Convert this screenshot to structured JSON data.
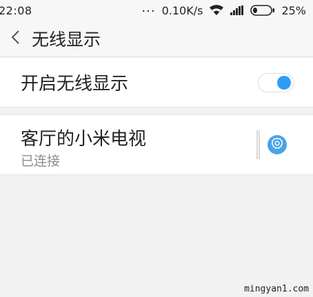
{
  "status_bar": {
    "time": "22:08",
    "dots": "...",
    "speed": "0.10K/s",
    "battery_percent": "25%",
    "battery_level": 0.25,
    "icons": [
      "wifi-icon",
      "signal-icon",
      "battery-icon"
    ]
  },
  "header": {
    "title": "无线显示",
    "back_icon": "chevron-left-icon"
  },
  "toggle_row": {
    "label": "开启无线显示",
    "enabled": true,
    "accent": "#2f9df6"
  },
  "device": {
    "name": "客厅的小米电视",
    "status": "已连接",
    "settings_icon": "gear-icon",
    "icon_color": "#4aa3e8"
  },
  "watermark": "mingyan1.com"
}
